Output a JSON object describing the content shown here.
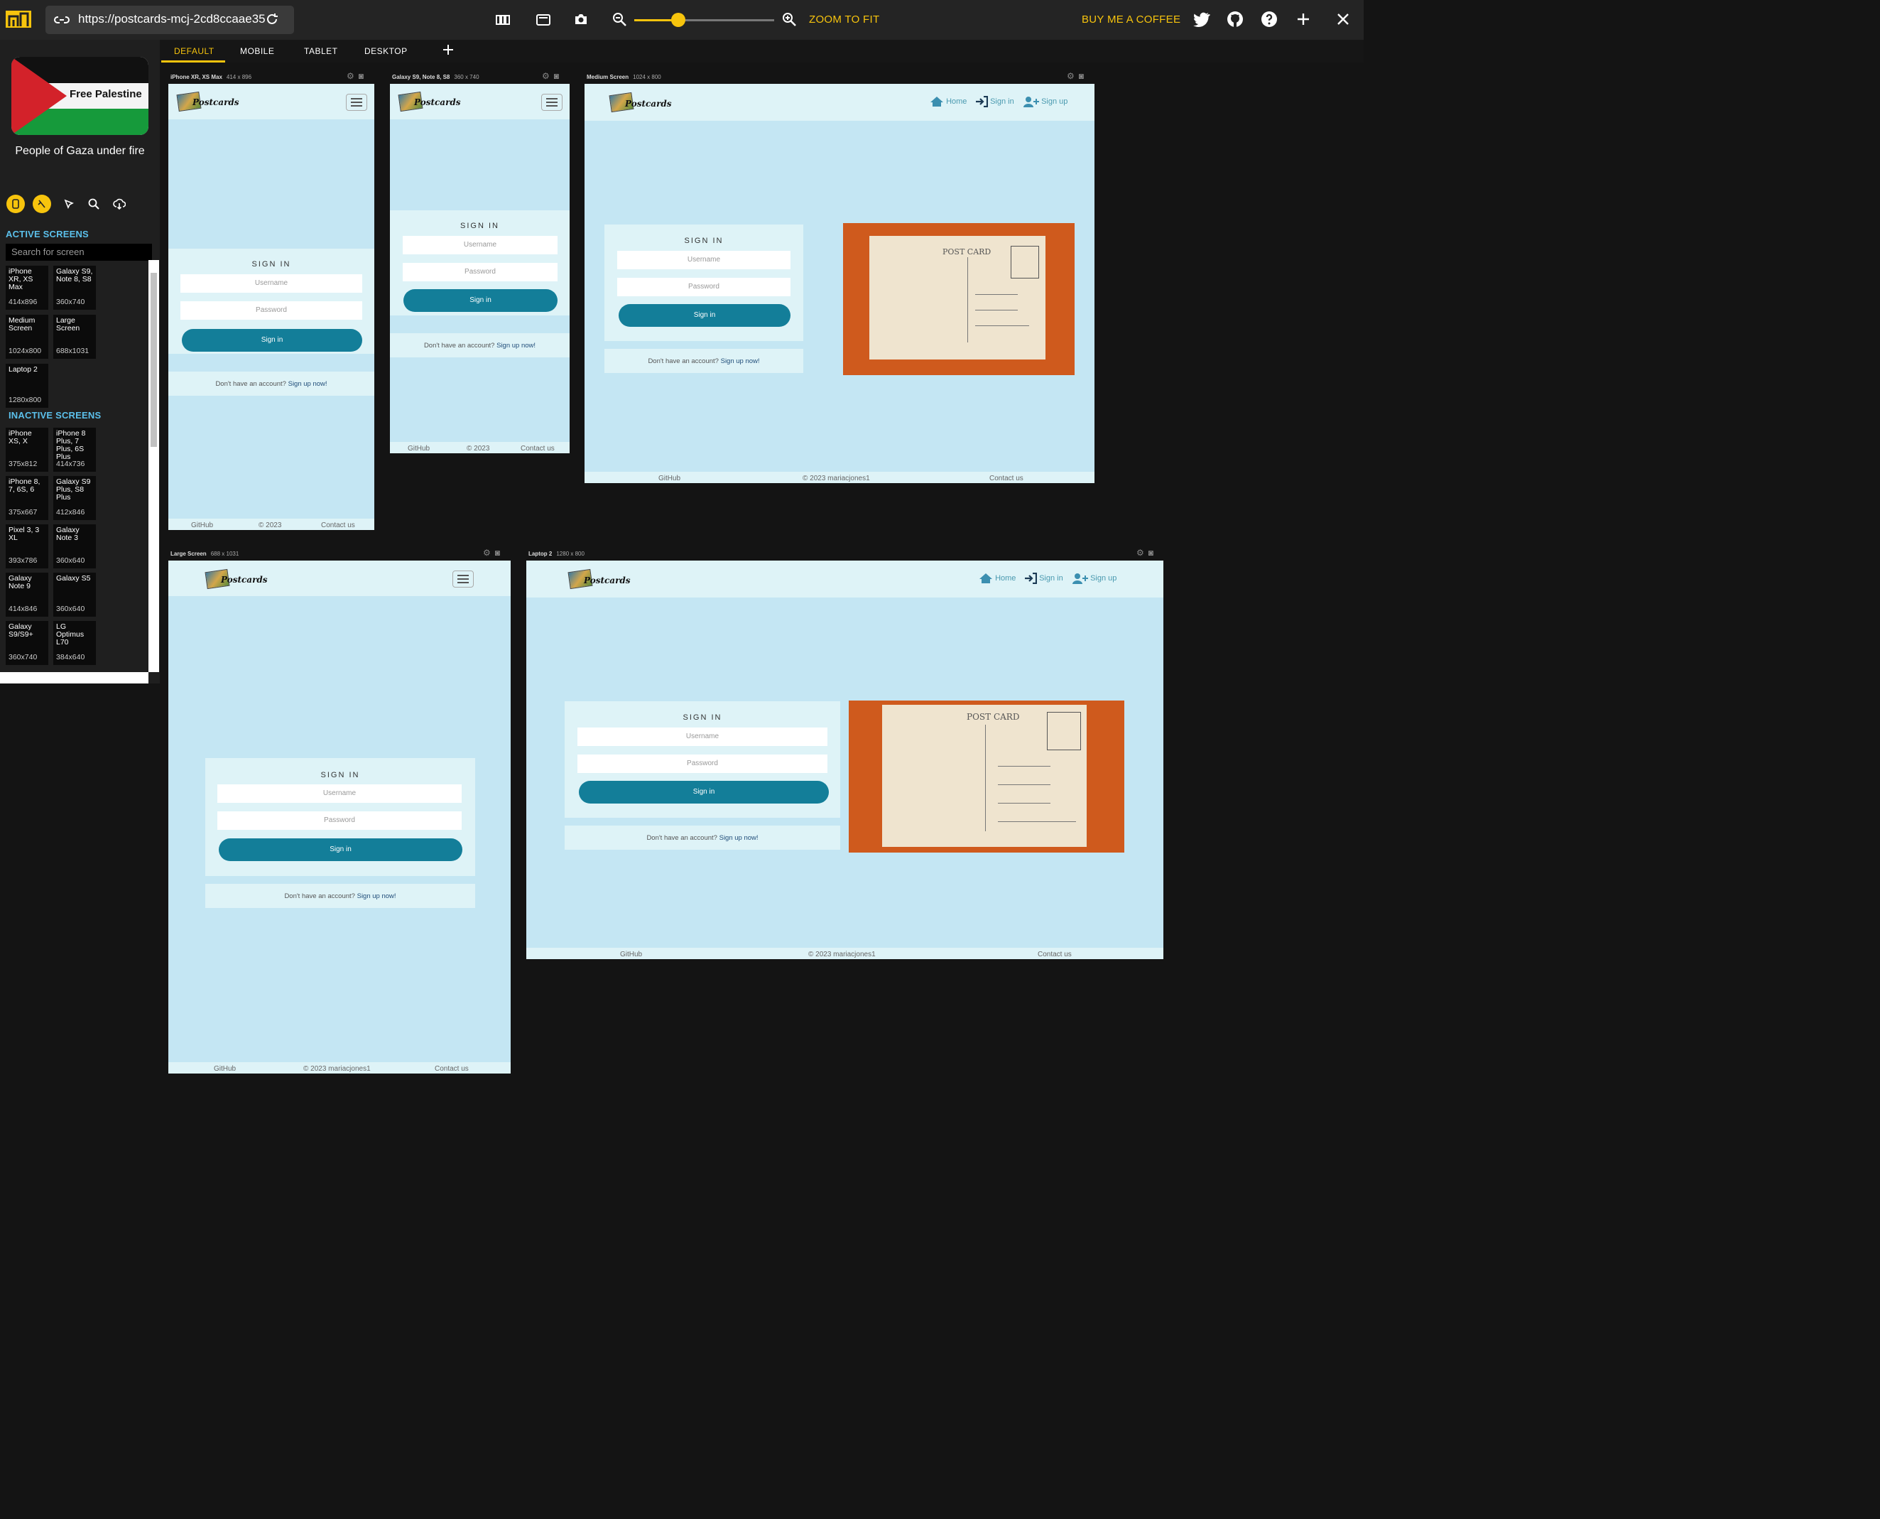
{
  "toolbar": {
    "url": "https://postcards-mcj-2cd8ccaae35",
    "zoom_to_fit": "ZOOM TO FIT",
    "buy_coffee": "BUY ME A COFFEE",
    "accent": "#f7c40d"
  },
  "sidebar": {
    "banner_text": "Free Palestine",
    "banner_caption": "People of Gaza under fire",
    "active_heading": "ACTIVE SCREENS",
    "search_placeholder": "Search for screen",
    "inactive_heading": "INACTIVE SCREENS",
    "active_screens": [
      {
        "name": "iPhone XR, XS Max",
        "dims": "414x896"
      },
      {
        "name": "Galaxy S9, Note 8, S8",
        "dims": "360x740"
      },
      {
        "name": "Medium Screen",
        "dims": "1024x800"
      },
      {
        "name": "Large Screen",
        "dims": "688x1031"
      },
      {
        "name": "Laptop 2",
        "dims": "1280x800"
      }
    ],
    "inactive_screens": [
      {
        "name": "iPhone XS, X",
        "dims": "375x812"
      },
      {
        "name": "iPhone 8 Plus, 7 Plus, 6S Plus",
        "dims": "414x736"
      },
      {
        "name": "iPhone 8, 7, 6S, 6",
        "dims": "375x667"
      },
      {
        "name": "Galaxy S9 Plus, S8 Plus",
        "dims": "412x846"
      },
      {
        "name": "Pixel 3, 3 XL",
        "dims": "393x786"
      },
      {
        "name": "Galaxy Note 3",
        "dims": "360x640"
      },
      {
        "name": "Galaxy Note 9",
        "dims": "414x846"
      },
      {
        "name": "Galaxy S5",
        "dims": "360x640"
      },
      {
        "name": "Galaxy S9/S9+",
        "dims": "360x740"
      },
      {
        "name": "LG Optimus L70",
        "dims": "384x640"
      }
    ]
  },
  "tabs": [
    "DEFAULT",
    "MOBILE",
    "TABLET",
    "DESKTOP"
  ],
  "devices": {
    "d1": {
      "name": "iPhone XR, XS Max",
      "dims": "414 x 896"
    },
    "d2": {
      "name": "Galaxy S9, Note 8, S8",
      "dims": "360 x 740"
    },
    "d3": {
      "name": "Medium Screen",
      "dims": "1024 x 800"
    },
    "d4": {
      "name": "Large Screen",
      "dims": "688 x 1031"
    },
    "d5": {
      "name": "Laptop 2",
      "dims": "1280 x 800"
    }
  },
  "site": {
    "brand": "Postcards",
    "nav_home": "Home",
    "nav_signin": "Sign in",
    "nav_signup": "Sign up",
    "sign_in_title": "SIGN IN",
    "username_placeholder": "Username",
    "password_placeholder": "Password",
    "sign_in_button": "Sign in",
    "no_account": "Don't have an account?",
    "sign_up_link": "Sign up now!",
    "footer_github": "GitHub",
    "footer_copy_short": "© 2023",
    "footer_copy": "© 2023 mariacjones1",
    "footer_contact": "Contact us",
    "postcard_title": "POST CARD"
  }
}
